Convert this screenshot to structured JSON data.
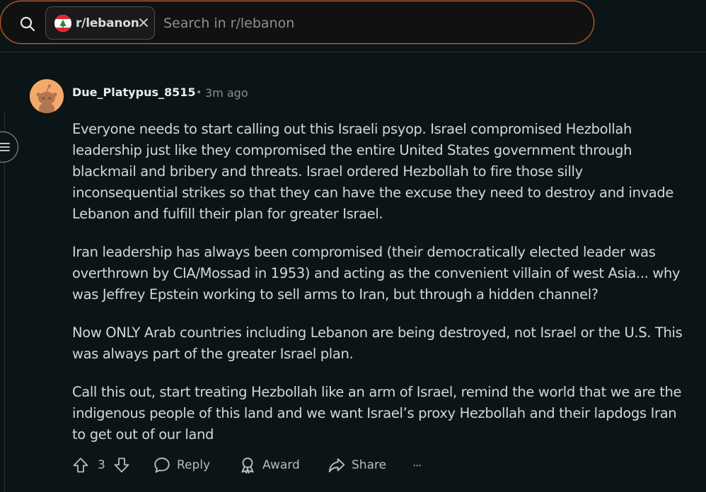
{
  "search": {
    "community_chip": "r/lebanon",
    "placeholder": "Search in r/lebanon"
  },
  "comment": {
    "author": "Due_Platypus_8515",
    "separator": "•",
    "time": "3m ago",
    "paragraphs": [
      "Everyone needs to start calling out this Israeli psyop. Israel compromised Hezbollah leadership just like they compromised the entire United States government through blackmail and bribery and threats. Israel ordered Hezbollah to fire those silly inconsequential strikes so that they can have the excuse they need to destroy and invade Lebanon and fulfill their plan for greater Israel.",
      "Iran leadership has always been compromised (their democratically elected leader was overthrown by CIA/Mossad in 1953) and acting as the convenient villain of west Asia... why was Jeffrey Epstein working to sell arms to Iran, but through a hidden channel?",
      "Now ONLY Arab countries including Lebanon are being destroyed, not Israel or the U.S. This was always part of the greater Israel plan.",
      "Call this out, start treating Hezbollah like an arm of Israel, remind the world that we are the indigenous people of this land and we want Israel’s proxy Hezbollah and their lapdogs Iran to get out of our land"
    ]
  },
  "actions": {
    "score": "3",
    "reply": "Reply",
    "award": "Award",
    "share": "Share",
    "more": "···"
  },
  "icons": {
    "search": "search-icon",
    "community_avatar": "community-avatar-icon",
    "close": "close-icon",
    "collapse": "collapse-thread-icon",
    "user_avatar": "snoo-avatar-icon",
    "upvote": "upvote-arrow-icon",
    "downvote": "downvote-arrow-icon",
    "reply": "speech-bubble-icon",
    "award": "award-ribbon-icon",
    "share": "share-arrow-icon",
    "more": "ellipsis-icon"
  },
  "colors": {
    "background": "#0b1416",
    "search_border_accent": "#d6612c",
    "text_primary": "#d4d7d9",
    "text_secondary": "#8a9195",
    "avatar_orange": "#f4a96a"
  }
}
